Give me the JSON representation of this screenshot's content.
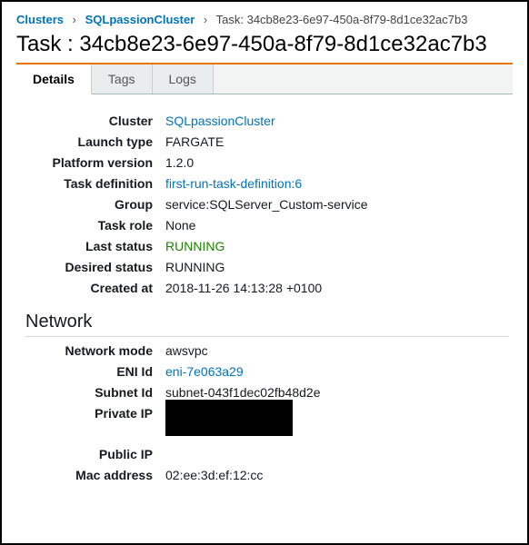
{
  "breadcrumb": {
    "root": "Clusters",
    "cluster": "SQLpassionCluster",
    "current_prefix": "Task: ",
    "current_id": "34cb8e23-6e97-450a-8f79-8d1ce32ac7b3"
  },
  "title_prefix": "Task : ",
  "title_id": "34cb8e23-6e97-450a-8f79-8d1ce32ac7b3",
  "tabs": {
    "details": "Details",
    "tags": "Tags",
    "logs": "Logs"
  },
  "details": {
    "labels": {
      "cluster": "Cluster",
      "launch_type": "Launch type",
      "platform_version": "Platform version",
      "task_definition": "Task definition",
      "group": "Group",
      "task_role": "Task role",
      "last_status": "Last status",
      "desired_status": "Desired status",
      "created_at": "Created at"
    },
    "values": {
      "cluster": "SQLpassionCluster",
      "launch_type": "FARGATE",
      "platform_version": "1.2.0",
      "task_definition": "first-run-task-definition:6",
      "group": "service:SQLServer_Custom-service",
      "task_role": "None",
      "last_status": "RUNNING",
      "desired_status": "RUNNING",
      "created_at": "2018-11-26 14:13:28 +0100"
    }
  },
  "network": {
    "header": "Network",
    "labels": {
      "network_mode": "Network mode",
      "eni_id": "ENI Id",
      "subnet_id": "Subnet Id",
      "private_ip": "Private IP",
      "public_ip": "Public IP",
      "mac_address": "Mac address"
    },
    "values": {
      "network_mode": "awsvpc",
      "eni_id": "eni-7e063a29",
      "subnet_id": "subnet-043f1dec02fb48d2e",
      "mac_address": "02:ee:3d:ef:12:cc"
    }
  }
}
